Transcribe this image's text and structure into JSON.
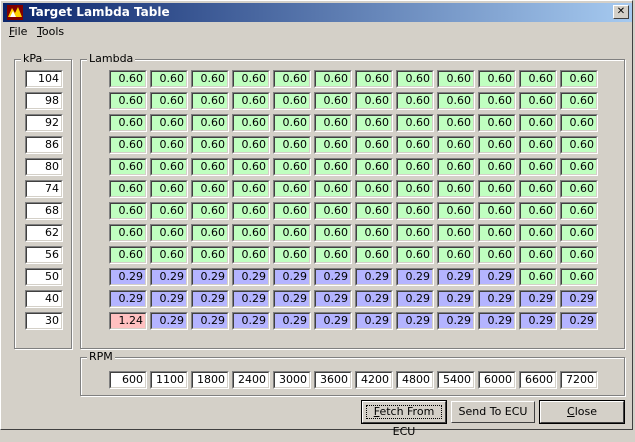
{
  "window": {
    "title": "Target Lambda Table"
  },
  "menu": {
    "file_label": "File",
    "file_mnemonic": "F",
    "file_rest": "ile",
    "tools_mnemonic": "T",
    "tools_rest": "ools"
  },
  "kpa_group": {
    "label": "kPa",
    "values": [
      "104",
      "98",
      "92",
      "86",
      "80",
      "74",
      "68",
      "62",
      "56",
      "50",
      "40",
      "30"
    ]
  },
  "lambda_group": {
    "label": "Lambda",
    "rows": [
      [
        "0.60",
        "0.60",
        "0.60",
        "0.60",
        "0.60",
        "0.60",
        "0.60",
        "0.60",
        "0.60",
        "0.60",
        "0.60",
        "0.60"
      ],
      [
        "0.60",
        "0.60",
        "0.60",
        "0.60",
        "0.60",
        "0.60",
        "0.60",
        "0.60",
        "0.60",
        "0.60",
        "0.60",
        "0.60"
      ],
      [
        "0.60",
        "0.60",
        "0.60",
        "0.60",
        "0.60",
        "0.60",
        "0.60",
        "0.60",
        "0.60",
        "0.60",
        "0.60",
        "0.60"
      ],
      [
        "0.60",
        "0.60",
        "0.60",
        "0.60",
        "0.60",
        "0.60",
        "0.60",
        "0.60",
        "0.60",
        "0.60",
        "0.60",
        "0.60"
      ],
      [
        "0.60",
        "0.60",
        "0.60",
        "0.60",
        "0.60",
        "0.60",
        "0.60",
        "0.60",
        "0.60",
        "0.60",
        "0.60",
        "0.60"
      ],
      [
        "0.60",
        "0.60",
        "0.60",
        "0.60",
        "0.60",
        "0.60",
        "0.60",
        "0.60",
        "0.60",
        "0.60",
        "0.60",
        "0.60"
      ],
      [
        "0.60",
        "0.60",
        "0.60",
        "0.60",
        "0.60",
        "0.60",
        "0.60",
        "0.60",
        "0.60",
        "0.60",
        "0.60",
        "0.60"
      ],
      [
        "0.60",
        "0.60",
        "0.60",
        "0.60",
        "0.60",
        "0.60",
        "0.60",
        "0.60",
        "0.60",
        "0.60",
        "0.60",
        "0.60"
      ],
      [
        "0.60",
        "0.60",
        "0.60",
        "0.60",
        "0.60",
        "0.60",
        "0.60",
        "0.60",
        "0.60",
        "0.60",
        "0.60",
        "0.60"
      ],
      [
        "0.29",
        "0.29",
        "0.29",
        "0.29",
        "0.29",
        "0.29",
        "0.29",
        "0.29",
        "0.29",
        "0.29",
        "0.60",
        "0.60"
      ],
      [
        "0.29",
        "0.29",
        "0.29",
        "0.29",
        "0.29",
        "0.29",
        "0.29",
        "0.29",
        "0.29",
        "0.29",
        "0.29",
        "0.29"
      ],
      [
        "1.24",
        "0.29",
        "0.29",
        "0.29",
        "0.29",
        "0.29",
        "0.29",
        "0.29",
        "0.29",
        "0.29",
        "0.29",
        "0.29"
      ]
    ],
    "colors": {
      "rich": "#b4b4ff",
      "lean": "#c0ffc0",
      "highlight": "#ffc0c0"
    }
  },
  "rpm_group": {
    "label": "RPM",
    "values": [
      "600",
      "1100",
      "1800",
      "2400",
      "3000",
      "3600",
      "4200",
      "4800",
      "5400",
      "6000",
      "6600",
      "7200"
    ]
  },
  "buttons": {
    "fetch_mnemonic": "F",
    "fetch_rest": "etch From ECU",
    "send_label": "Send To ECU",
    "close_mnemonic": "C",
    "close_rest": "lose"
  }
}
